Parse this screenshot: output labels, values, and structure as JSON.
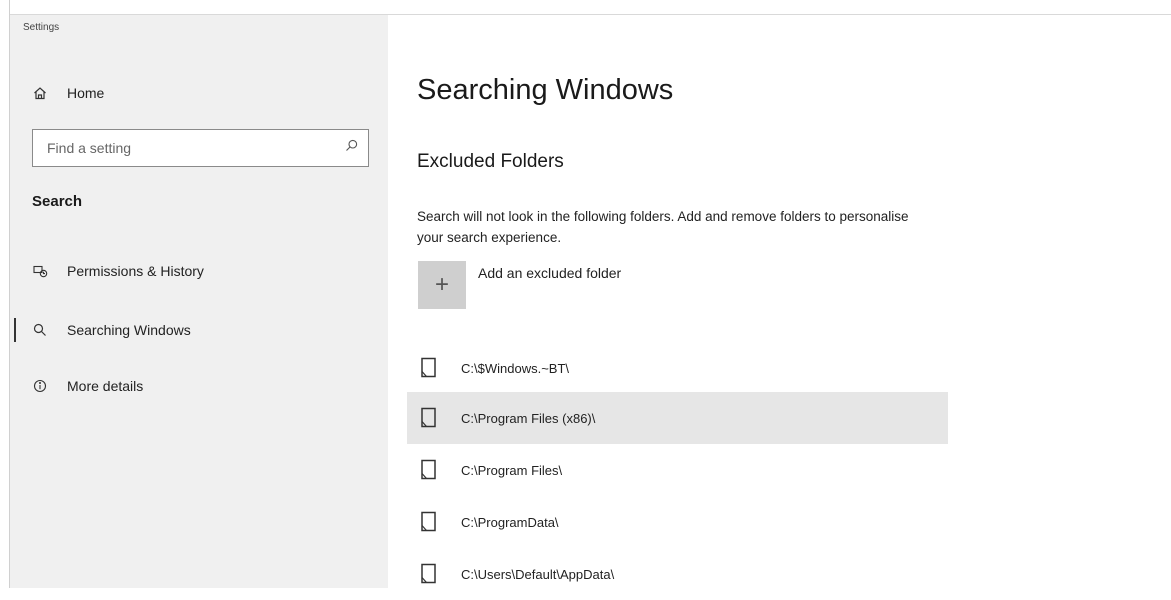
{
  "window": {
    "title": "Settings"
  },
  "sidebar": {
    "home_label": "Home",
    "search_placeholder": "Find a setting",
    "section_label": "Search",
    "items": [
      {
        "label": "Permissions & History",
        "icon": "permissions-icon",
        "active": false
      },
      {
        "label": "Searching Windows",
        "icon": "search-icon",
        "active": true
      },
      {
        "label": "More details",
        "icon": "info-icon",
        "active": false
      }
    ]
  },
  "main": {
    "title": "Searching Windows",
    "subheading": "Excluded Folders",
    "description": "Search will not look in the following folders. Add and remove folders to personalise your search experience.",
    "add_label": "Add an excluded folder",
    "add_icon": "plus-icon",
    "folders": [
      {
        "path": "C:\\$Windows.~BT\\",
        "selected": false
      },
      {
        "path": "C:\\Program Files (x86)\\",
        "selected": true
      },
      {
        "path": "C:\\Program Files\\",
        "selected": false
      },
      {
        "path": "C:\\ProgramData\\",
        "selected": false
      },
      {
        "path": "C:\\Users\\Default\\AppData\\",
        "selected": false
      }
    ]
  },
  "colors": {
    "sidebar_bg": "#f0f0f0",
    "selected_row_bg": "#e6e6e6",
    "add_tile_bg": "#cfcfcf"
  }
}
